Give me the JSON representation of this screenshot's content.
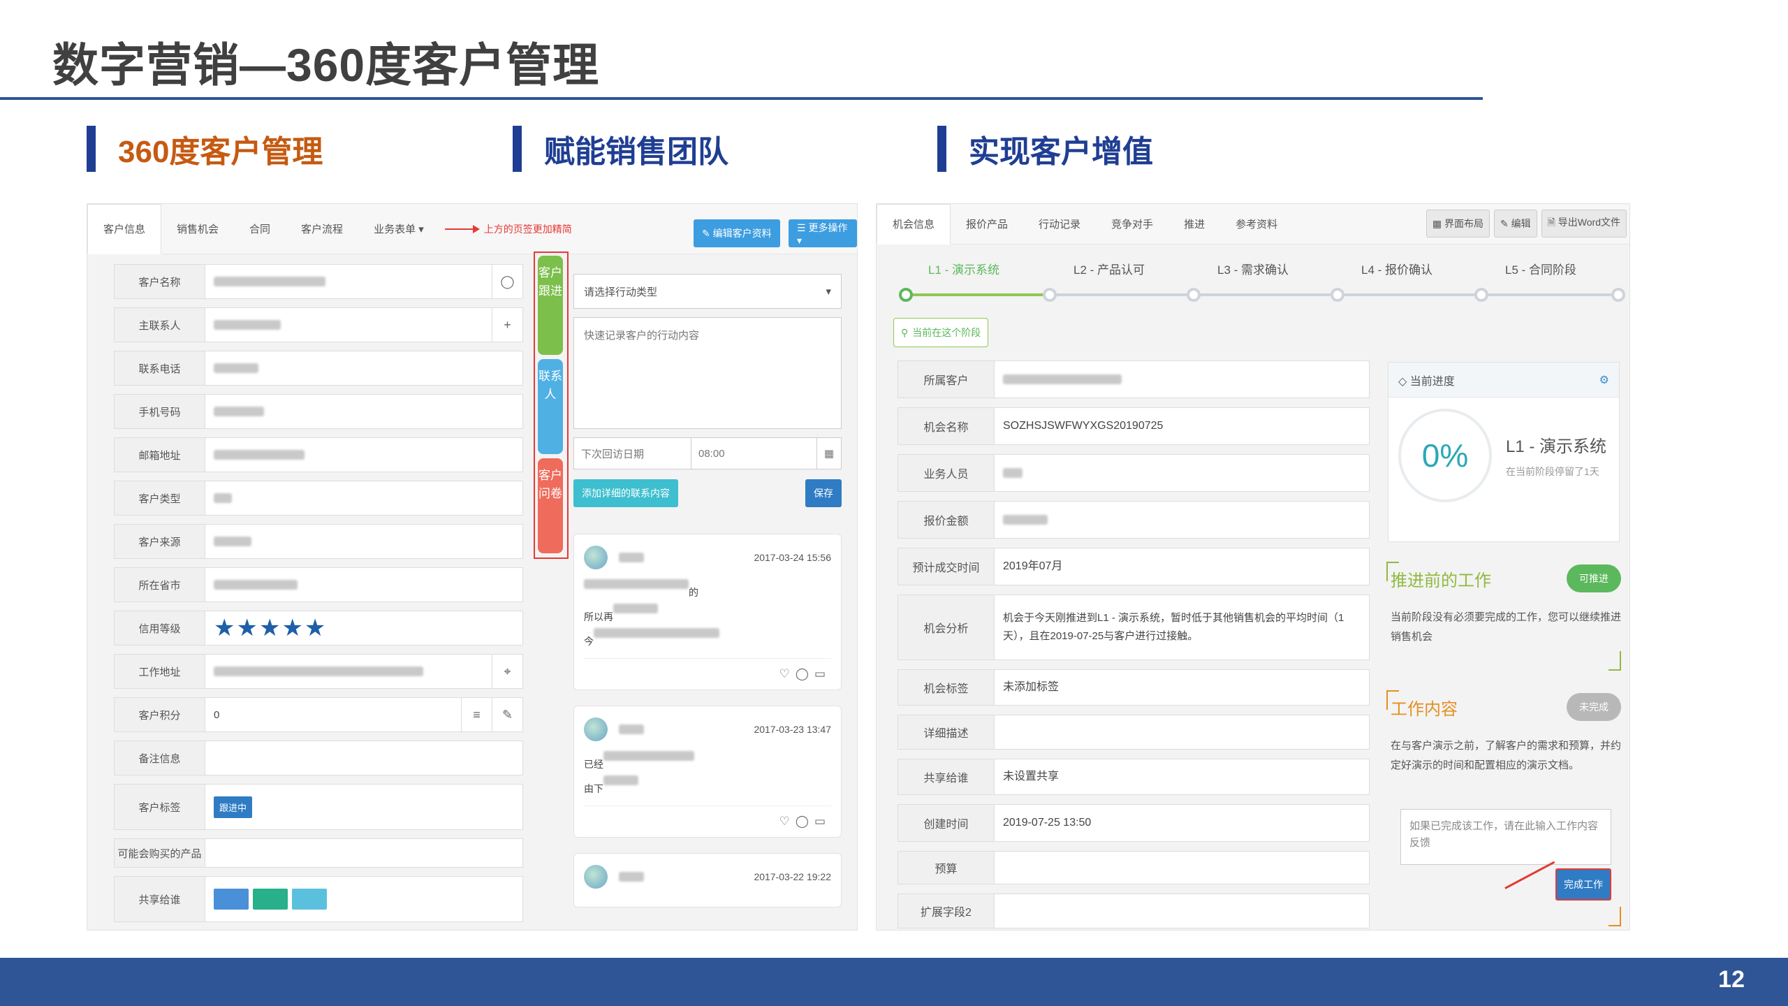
{
  "slide": {
    "title": "数字营销—360度客户管理",
    "page_number": "12"
  },
  "sections": [
    {
      "label": "360度客户管理",
      "color": "#c55a11"
    },
    {
      "label": "赋能销售团队",
      "color": "#1f3e93"
    },
    {
      "label": "实现客户增值",
      "color": "#1f3e93"
    }
  ],
  "left": {
    "tabs": [
      "客户信息",
      "销售机会",
      "合同",
      "客户流程",
      "业务表单 ▾"
    ],
    "tab_note": "上方的页签更加精简",
    "buttons": {
      "edit": "✎ 编辑客户资料",
      "more": "☰ 更多操作 ▾"
    },
    "fields": [
      {
        "label": "客户名称",
        "icon": "chat-icon"
      },
      {
        "label": "主联系人",
        "icon": "plus-icon"
      },
      {
        "label": "联系电话"
      },
      {
        "label": "手机号码"
      },
      {
        "label": "邮箱地址"
      },
      {
        "label": "客户类型"
      },
      {
        "label": "客户来源"
      },
      {
        "label": "所在省市"
      },
      {
        "label": "信用等级",
        "stars": "★★★★★"
      },
      {
        "label": "工作地址",
        "icon": "location-icon"
      },
      {
        "label": "客户积分",
        "value": "0"
      },
      {
        "label": "备注信息"
      },
      {
        "label": "客户标签",
        "tag": "跟进中"
      },
      {
        "label": "可能会购买的产品"
      },
      {
        "label": "共享给谁"
      }
    ],
    "side_tabs": [
      {
        "label": "客户跟进",
        "color": "#7cbf4b"
      },
      {
        "label": "联系人",
        "color": "#4fb0e3"
      },
      {
        "label": "客户问卷",
        "color": "#ef6b5b"
      }
    ],
    "action": {
      "type_placeholder": "请选择行动类型",
      "content_placeholder": "快速记录客户的行动内容",
      "next_date_placeholder": "下次回访日期",
      "time": "08:00",
      "add_detail": "添加详细的联系内容",
      "save": "保存"
    },
    "feed": [
      {
        "time": "2017-03-24 15:56",
        "line1": "的",
        "line2": "所以再",
        "line3": "今"
      },
      {
        "time": "2017-03-23 13:47",
        "line1": "已经",
        "line2": "由下"
      },
      {
        "time": "2017-03-22 19:22"
      }
    ]
  },
  "right": {
    "tabs": [
      "机会信息",
      "报价产品",
      "行动记录",
      "竞争对手",
      "推进",
      "参考资料"
    ],
    "toolbar": [
      "▦ 界面布局",
      "✎ 编辑",
      "🗎 导出Word文件"
    ],
    "stages": [
      "L1 - 演示系统",
      "L2 - 产品认可",
      "L3 - 需求确认",
      "L4 - 报价确认",
      "L5 - 合同阶段"
    ],
    "current_stage_note": "当前在这个阶段",
    "fields": [
      {
        "label": "所属客户",
        "value": ""
      },
      {
        "label": "机会名称",
        "value": "SOZHSJSWFWYXGS20190725"
      },
      {
        "label": "业务人员",
        "value": ""
      },
      {
        "label": "报价金额",
        "value": ""
      },
      {
        "label": "预计成交时间",
        "value": "2019年07月"
      },
      {
        "label": "机会分析",
        "value": "机会于今天刚推进到L1 - 演示系统，暂时低于其他销售机会的平均时间（1天），且在2019-07-25与客户进行过接触。"
      },
      {
        "label": "机会标签",
        "value": "未添加标签"
      },
      {
        "label": "详细描述",
        "value": ""
      },
      {
        "label": "共享给谁",
        "value": "未设置共享"
      },
      {
        "label": "创建时间",
        "value": "2019-07-25 13:50"
      },
      {
        "label": "预算",
        "value": ""
      },
      {
        "label": "扩展字段2",
        "value": ""
      }
    ],
    "progress": {
      "title": "当前进度",
      "percent": "0%",
      "stage": "L1 - 演示系统",
      "sub": "在当前阶段停留了1天"
    },
    "prior_work": {
      "title": "推进前的工作",
      "status": "可推进",
      "text": "当前阶段没有必须要完成的工作，您可以继续推进销售机会"
    },
    "work_content": {
      "title": "工作内容",
      "status": "未完成",
      "text": "在与客户演示之前，了解客户的需求和预算，并约定好演示的时间和配置相应的演示文档。"
    },
    "feedback_placeholder": "如果已完成该工作，请在此输入工作内容反馈",
    "done_button": "完成工作"
  }
}
